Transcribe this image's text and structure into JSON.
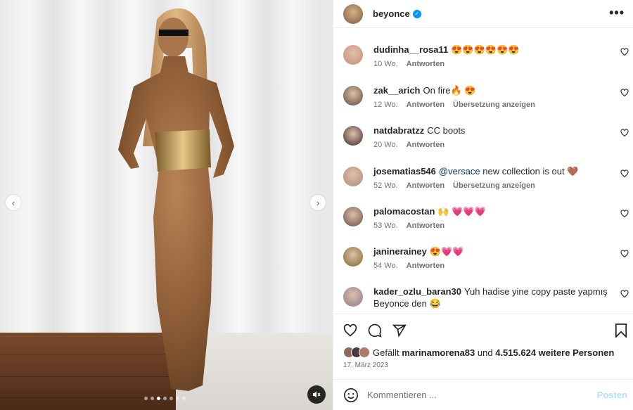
{
  "post": {
    "username": "beyonce",
    "verified": true,
    "more_label": "•••",
    "carousel": {
      "total": 7,
      "active": 3
    }
  },
  "comments": [
    {
      "user": "dudinha__rosa11",
      "text": "😍😍😍😍😍😍",
      "time": "10 Wo.",
      "reply": "Antworten",
      "translate": "",
      "avatar_color": "#c98b7a"
    },
    {
      "user": "zak__arich",
      "text": "On fire🔥 😍",
      "time": "12 Wo.",
      "reply": "Antworten",
      "translate": "Übersetzung anzeigen",
      "avatar_color": "#5a4a3a"
    },
    {
      "user": "natdabratzz",
      "text": "CC boots",
      "time": "20 Wo.",
      "reply": "Antworten",
      "translate": "",
      "avatar_color": "#3a2a2a"
    },
    {
      "user": "josematias546",
      "mention": "@versace",
      "text": " new collection is out 🤎",
      "time": "52 Wo.",
      "reply": "Antworten",
      "translate": "Übersetzung anzeigen",
      "avatar_color": "#b08a7a"
    },
    {
      "user": "palomacostan",
      "text": "🙌 💗💗💗",
      "time": "53 Wo.",
      "reply": "Antworten",
      "translate": "",
      "avatar_color": "#6a4a4a"
    },
    {
      "user": "janinerainey",
      "text": "😍💗💗",
      "time": "54 Wo.",
      "reply": "Antworten",
      "translate": "",
      "avatar_color": "#7a6a2a"
    },
    {
      "user": "kader_ozlu_baran30",
      "text": "Yuh hadise yine copy paste yapmış Beyonce den 😂",
      "time": "",
      "reply": "",
      "translate": "",
      "avatar_color": "#8a7a8a"
    }
  ],
  "likes": {
    "prefix": "Gefällt",
    "user": "marinamorena83",
    "middle": "und",
    "count": "4.515.624 weitere Personen"
  },
  "date": "17. März 2023",
  "comment_box": {
    "placeholder": "Kommentieren ...",
    "post_label": "Posten"
  }
}
